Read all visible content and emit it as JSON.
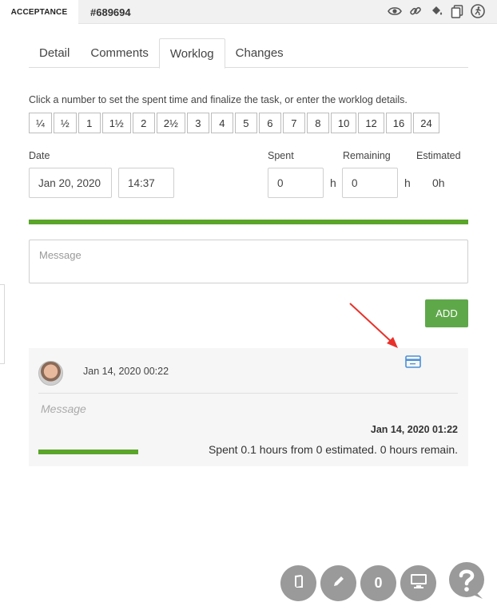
{
  "header": {
    "status": "ACCEPTANCE",
    "task_id": "#689694",
    "icons": [
      "eye-icon",
      "link-icon",
      "paint-bucket-icon",
      "copy-icon",
      "runner-icon"
    ]
  },
  "tabs": [
    {
      "label": "Detail",
      "active": false
    },
    {
      "label": "Comments",
      "active": false
    },
    {
      "label": "Worklog",
      "active": true
    },
    {
      "label": "Changes",
      "active": false
    }
  ],
  "worklog": {
    "hint": "Click a number to set the spent time and finalize the task, or enter the worklog details.",
    "quick_values": [
      "¼",
      "½",
      "1",
      "1½",
      "2",
      "2½",
      "3",
      "4",
      "5",
      "6",
      "7",
      "8",
      "10",
      "12",
      "16",
      "24"
    ],
    "date_label": "Date",
    "date_value": "Jan 20, 2020",
    "time_value": "14:37",
    "spent_label": "Spent",
    "spent_value": "0",
    "spent_unit": "h",
    "remaining_label": "Remaining",
    "remaining_value": "0",
    "remaining_unit": "h",
    "estimated_label": "Estimated",
    "estimated_value": "0h",
    "progress": 1.0,
    "message_placeholder": "Message",
    "add_label": "ADD"
  },
  "entry": {
    "date": "Jan 14, 2020 00:22",
    "message_placeholder": "Message",
    "logged_date": "Jan 14, 2020 01:22",
    "summary": "Spent 0.1 hours from 0 estimated. 0 hours remain.",
    "progress": 1.0
  },
  "fabs": {
    "count": "0"
  },
  "colors": {
    "accent_green": "#5aa52a",
    "button_green": "#5fa84a",
    "fab_gray": "#9a9a9a",
    "arrow_red": "#e8312a",
    "icon_blue": "#4a90d9"
  }
}
